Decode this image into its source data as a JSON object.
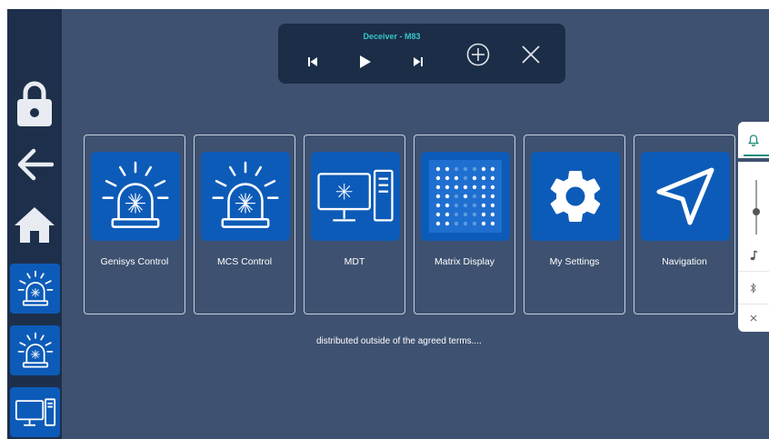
{
  "player": {
    "track_title": "Deceiver - M83",
    "controls": [
      "previous-icon",
      "play-icon",
      "next-icon",
      "add-circle-icon",
      "close-icon"
    ]
  },
  "sidebar": {
    "items": [
      "lock-icon",
      "back-arrow-icon",
      "home-icon",
      "siren-icon",
      "siren-icon",
      "computer-icon"
    ]
  },
  "apps": [
    {
      "label": "Genisys Control",
      "icon": "siren-icon"
    },
    {
      "label": "MCS Control",
      "icon": "siren-icon"
    },
    {
      "label": "MDT",
      "icon": "computer-icon"
    },
    {
      "label": "Matrix Display",
      "icon": "matrix-m-icon"
    },
    {
      "label": "My Settings",
      "icon": "gear-icon"
    },
    {
      "label": "Navigation",
      "icon": "navigation-arrow-icon"
    }
  ],
  "notice": "distributed outside of the agreed terms....",
  "quick_settings": {
    "icons": [
      "bell-icon",
      "volume-slider",
      "music-note-icon",
      "bluetooth-icon",
      "close-icon"
    ],
    "volume_level": 0.58
  },
  "colors": {
    "background": "#3e5170",
    "sidebar": "#1d2f4a",
    "tile_blue": "#0d5bb8",
    "accent_teal": "#39c4c9"
  }
}
